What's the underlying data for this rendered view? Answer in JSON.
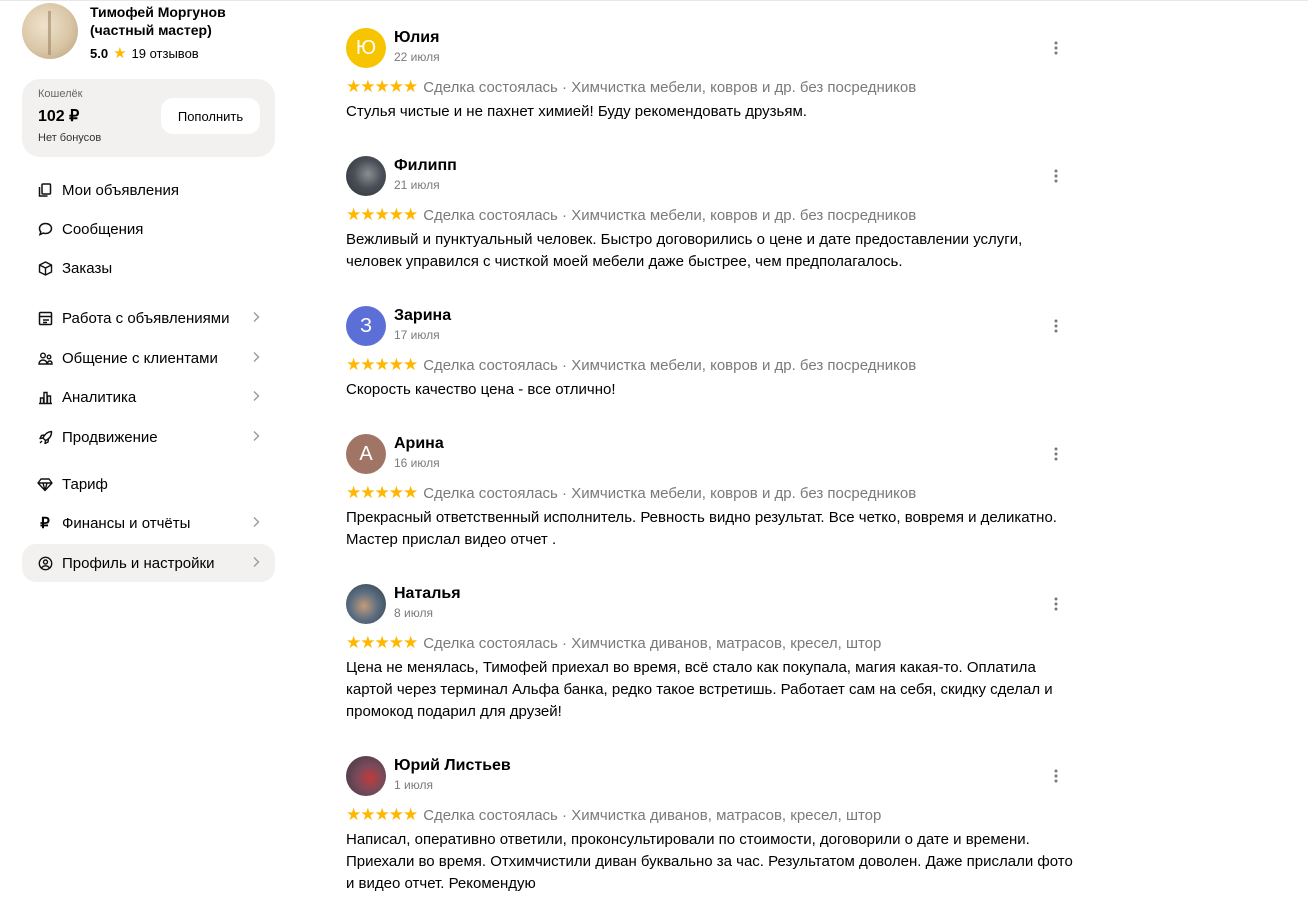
{
  "profile": {
    "name": "Тимофей Моргунов (частный мастер)",
    "score": "5.0",
    "reviews_count": "19 отзывов"
  },
  "wallet": {
    "label": "Кошелёк",
    "amount": "102 ₽",
    "bonus": "Нет бонусов",
    "topup_label": "Пополнить"
  },
  "nav": {
    "items": [
      {
        "label": "Мои объявления",
        "icon": "copy-icon",
        "chevron": false,
        "active": false
      },
      {
        "label": "Сообщения",
        "icon": "chat-bubble-icon",
        "chevron": false,
        "active": false
      },
      {
        "label": "Заказы",
        "icon": "box-icon",
        "chevron": false,
        "active": false
      },
      {
        "label": "Работа с объявлениями",
        "icon": "layout-icon",
        "chevron": true,
        "active": false
      },
      {
        "label": "Общение с клиентами",
        "icon": "people-icon",
        "chevron": true,
        "active": false
      },
      {
        "label": "Аналитика",
        "icon": "bar-chart-icon",
        "chevron": true,
        "active": false
      },
      {
        "label": "Продвижение",
        "icon": "rocket-icon",
        "chevron": true,
        "active": false
      },
      {
        "label": "Тариф",
        "icon": "diamond-icon",
        "chevron": false,
        "active": false
      },
      {
        "label": "Финансы и отчёты",
        "icon": "ruble-icon",
        "chevron": true,
        "active": false
      },
      {
        "label": "Профиль и настройки",
        "icon": "user-circle-icon",
        "chevron": true,
        "active": true
      }
    ]
  },
  "reviews": [
    {
      "name": "Юлия",
      "date": "22 июля",
      "initial": "Ю",
      "avatar_color": "#f7c400",
      "photo": false,
      "stars": "★★★★★",
      "meta": "Сделка состоялась · Химчистка мебели, ковров и др. без посредников",
      "text": "Стулья чистые и не пахнет химией! Буду рекомендовать друзьям."
    },
    {
      "name": "Филипп",
      "date": "21 июля",
      "initial": "",
      "avatar_color": "#4a4f57",
      "photo": true,
      "stars": "★★★★★",
      "meta": "Сделка состоялась · Химчистка мебели, ковров и др. без посредников",
      "text": "Вежливый и пунктуальный человек. Быстро договорились о цене и дате предоставлении услуги, человек управился с чисткой моей мебели даже быстрее, чем предполагалось."
    },
    {
      "name": "Зарина",
      "date": "17 июля",
      "initial": "З",
      "avatar_color": "#5b6fd6",
      "photo": false,
      "stars": "★★★★★",
      "meta": "Сделка состоялась · Химчистка мебели, ковров и др. без посредников",
      "text": "Скорость качество цена - все отлично!"
    },
    {
      "name": "Арина",
      "date": "16 июля",
      "initial": "А",
      "avatar_color": "#a17566",
      "photo": false,
      "stars": "★★★★★",
      "meta": "Сделка состоялась · Химчистка мебели, ковров и др. без посредников",
      "text": "Прекрасный ответственный исполнитель. Ревность видно результат. Все четко, вовремя и деликатно. Мастер прислал видео отчет ."
    },
    {
      "name": "Наталья",
      "date": "8 июля",
      "initial": "",
      "avatar_color": "#3d5266",
      "photo": true,
      "stars": "★★★★★",
      "meta": "Сделка состоялась · Химчистка диванов, матрасов, кресел, штор",
      "text": "Цена не менялась, Тимофей приехал во время, всё стало как покупала, магия какая-то. Оплатила картой через терминал Альфа банка, редко такое встретишь. Работает сам на себя, скидку сделал и промокод подарил для друзей!"
    },
    {
      "name": "Юрий Листьев",
      "date": "1 июля",
      "initial": "",
      "avatar_color": "#5a4a52",
      "photo": true,
      "stars": "★★★★★",
      "meta": "Сделка состоялась · Химчистка диванов, матрасов, кресел, штор",
      "text": "Написал, оперативно ответили, проконсультировали по стоимости, договорили о дате и времени. Приехали во время. Отхимчистили диван буквально за час. Результатом доволен. Даже прислали фото и видео отчет. Рекомендую"
    }
  ]
}
